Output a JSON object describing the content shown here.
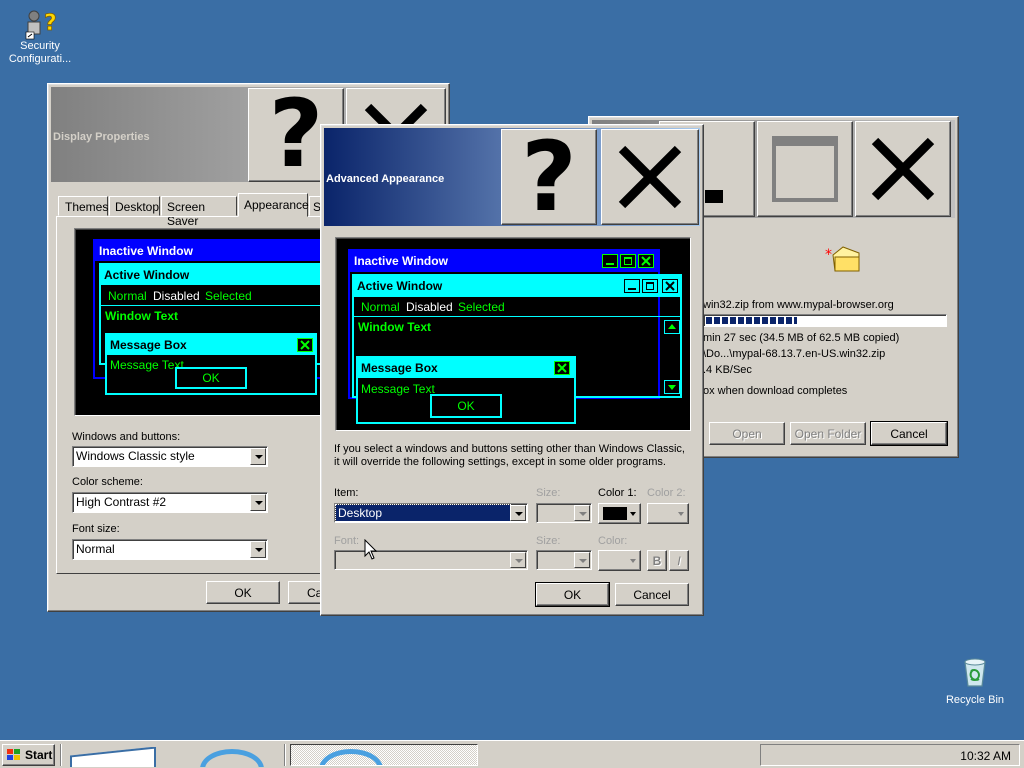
{
  "desktop": {
    "icons": [
      {
        "label_line1": "Security",
        "label_line2": "Configurati..."
      },
      {
        "label_line1": "Recycle Bin",
        "label_line2": ""
      }
    ]
  },
  "display_properties": {
    "title": "Display Properties",
    "tabs": [
      "Themes",
      "Desktop",
      "Screen Saver",
      "Appearance",
      "S"
    ],
    "preview": {
      "inactive": "Inactive Window",
      "active": "Active Window",
      "menu": [
        "Normal",
        "Disabled",
        "Selected"
      ],
      "window_text": "Window Text",
      "msgbox_title": "Message Box",
      "msgbox_text": "Message Text",
      "ok": "OK"
    },
    "windows_buttons_label": "Windows and buttons:",
    "windows_buttons_value": "Windows Classic style",
    "color_scheme_label": "Color scheme:",
    "color_scheme_value": "High Contrast #2",
    "font_size_label": "Font size:",
    "font_size_value": "Normal",
    "ok": "OK",
    "cancel": "Ca"
  },
  "download": {
    "line_from": "win32.zip from www.mypal-browser.org",
    "progress": 0.38,
    "line_time": "min 27 sec (34.5 MB of 62.5 MB copied)",
    "line_path": "\\Do...\\mypal-68.13.7.en-US.win32.zip",
    "line_rate": ".4 KB/Sec",
    "line_close": "ox when download completes",
    "open": "Open",
    "open_folder": "Open Folder",
    "cancel": "Cancel"
  },
  "advanced": {
    "title": "Advanced Appearance",
    "preview": {
      "inactive": "Inactive Window",
      "active": "Active Window",
      "menu": [
        "Normal",
        "Disabled",
        "Selected"
      ],
      "window_text": "Window Text",
      "msgbox_title": "Message Box",
      "msgbox_text": "Message Text",
      "ok": "OK"
    },
    "info_line1": "If you select a windows and buttons setting other than Windows Classic,",
    "info_line2": "it will override the following settings, except in some older programs.",
    "item_label": "Item:",
    "item_value": "Desktop",
    "size_label": "Size:",
    "color1_label": "Color 1:",
    "color2_label": "Color 2:",
    "font_label": "Font:",
    "font_size_label": "Size:",
    "font_color_label": "Color:",
    "bold": "B",
    "italic": "I",
    "ok": "OK",
    "cancel": "Cancel"
  },
  "taskbar": {
    "start": "Start",
    "clock": "10:32 AM"
  },
  "colors": {
    "desktop": "#3a6ea5",
    "hc_cyan": "#00ffff",
    "hc_green": "#00ff00",
    "selection": "#0a246a"
  }
}
